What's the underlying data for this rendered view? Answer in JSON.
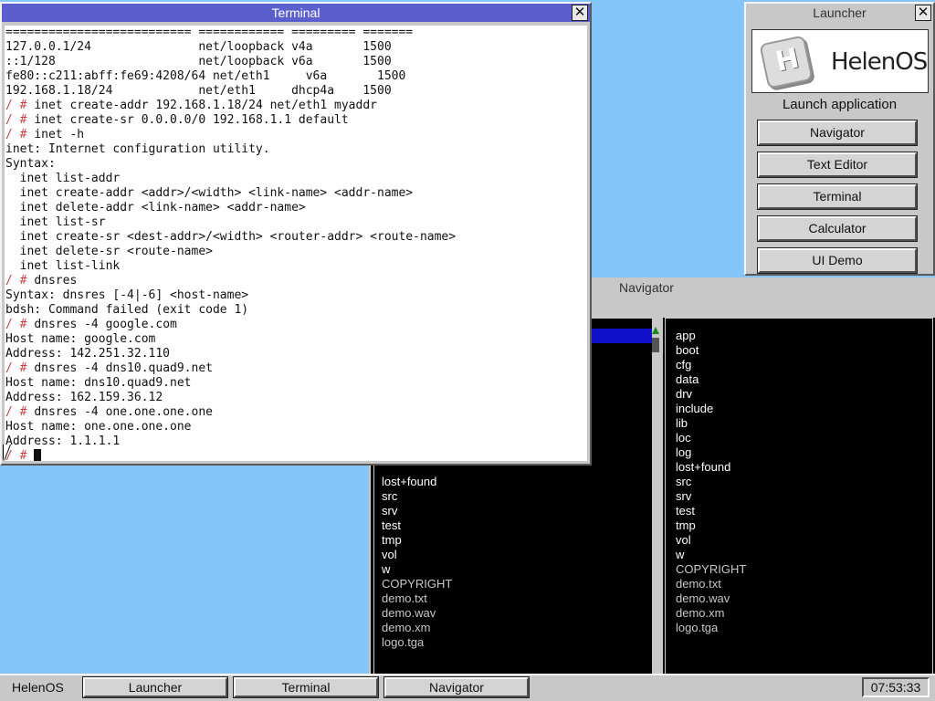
{
  "terminal": {
    "title": "Terminal",
    "lines": [
      {
        "prompt": "",
        "text": "========================== ============ ========= ======="
      },
      {
        "prompt": "",
        "text": "127.0.0.1/24               net/loopback v4a       1500"
      },
      {
        "prompt": "",
        "text": "::1/128                    net/loopback v6a       1500"
      },
      {
        "prompt": "",
        "text": "fe80::c211:abff:fe69:4208/64 net/eth1     v6a       1500"
      },
      {
        "prompt": "",
        "text": "192.168.1.18/24            net/eth1     dhcp4a    1500"
      },
      {
        "prompt": "/ # ",
        "text": "inet create-addr 192.168.1.18/24 net/eth1 myaddr"
      },
      {
        "prompt": "/ # ",
        "text": "inet create-sr 0.0.0.0/0 192.168.1.1 default"
      },
      {
        "prompt": "/ # ",
        "text": "inet -h"
      },
      {
        "prompt": "",
        "text": "inet: Internet configuration utility."
      },
      {
        "prompt": "",
        "text": "Syntax:"
      },
      {
        "prompt": "",
        "text": "  inet list-addr"
      },
      {
        "prompt": "",
        "text": "  inet create-addr <addr>/<width> <link-name> <addr-name>"
      },
      {
        "prompt": "",
        "text": "  inet delete-addr <link-name> <addr-name>"
      },
      {
        "prompt": "",
        "text": "  inet list-sr"
      },
      {
        "prompt": "",
        "text": "  inet create-sr <dest-addr>/<width> <router-addr> <route-name>"
      },
      {
        "prompt": "",
        "text": "  inet delete-sr <route-name>"
      },
      {
        "prompt": "",
        "text": "  inet list-link"
      },
      {
        "prompt": "/ # ",
        "text": "dnsres"
      },
      {
        "prompt": "",
        "text": "Syntax: dnsres [-4|-6] <host-name>"
      },
      {
        "prompt": "",
        "text": "bdsh: Command failed (exit code 1)"
      },
      {
        "prompt": "/ # ",
        "text": "dnsres -4 google.com"
      },
      {
        "prompt": "",
        "text": "Host name: google.com"
      },
      {
        "prompt": "",
        "text": "Address: 142.251.32.110"
      },
      {
        "prompt": "/ # ",
        "text": "dnsres -4 dns10.quad9.net"
      },
      {
        "prompt": "",
        "text": "Host name: dns10.quad9.net"
      },
      {
        "prompt": "",
        "text": "Address: 162.159.36.12"
      },
      {
        "prompt": "/ # ",
        "text": "dnsres -4 one.one.one.one"
      },
      {
        "prompt": "",
        "text": "Host name: one.one.one.one"
      },
      {
        "prompt": "",
        "text": "Address: 1.1.1.1"
      }
    ],
    "current_prompt": "/ # "
  },
  "launcher": {
    "title": "Launcher",
    "logo_text": "HelenOS",
    "launch_label": "Launch application",
    "buttons": [
      "Navigator",
      "Text Editor",
      "Terminal",
      "Calculator",
      "UI Demo"
    ]
  },
  "navigator": {
    "title": "Navigator",
    "left_visible": [
      "lost+found",
      "src",
      "srv",
      "test",
      "tmp",
      "vol",
      "w"
    ],
    "left_files": [
      "COPYRIGHT",
      "demo.txt",
      "demo.wav",
      "demo.xm",
      "logo.tga"
    ],
    "right_dirs": [
      "app",
      "boot",
      "cfg",
      "data",
      "drv",
      "include",
      "lib",
      "loc",
      "log",
      "lost+found",
      "src",
      "srv",
      "test",
      "tmp",
      "vol",
      "w"
    ],
    "right_files": [
      "COPYRIGHT",
      "demo.txt",
      "demo.wav",
      "demo.xm",
      "logo.tga"
    ]
  },
  "taskbar": {
    "start_label": "HelenOS",
    "buttons": [
      "Launcher",
      "Terminal",
      "Navigator"
    ],
    "clock": "07:53:33"
  },
  "colors": {
    "desktop": "#85c6fa",
    "title_active": "#5b5fce",
    "prompt": "#cc4444",
    "selection": "#1010c8"
  }
}
